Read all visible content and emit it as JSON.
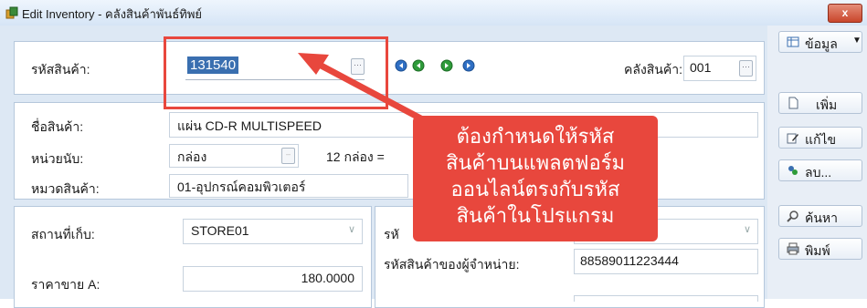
{
  "window": {
    "title": "Edit Inventory - คลังสินค้าพันธ์ทิพย์",
    "close_label": "x"
  },
  "header": {
    "product_code_label": "รหัสสินค้า:",
    "product_code_value": "131540",
    "warehouse_label": "คลังสินค้า:",
    "warehouse_value": "001"
  },
  "info": {
    "name_label": "ชื่อสินค้า:",
    "name_value": "แผ่น CD-R MULTISPEED",
    "unit_label": "หน่วยนับ:",
    "unit_value": "กล่อง",
    "unit_conversion": "12 กล่อง =",
    "category_label": "หมวดสินค้า:",
    "category_value": "01-อุปกรณ์คอมพิวเตอร์"
  },
  "storage": {
    "location_label": "สถานที่เก็บ:",
    "location_value": "STORE01",
    "price_a_label": "ราคาขาย A:",
    "price_a_value": "180.0000",
    "right_label_partial": "รหั",
    "supplier_code_label": "รหัสสินค้าของผู้จำหน่าย:",
    "supplier_code_value": "88589011223444"
  },
  "sidebar": {
    "data_label": "ข้อมูล",
    "add_label": "เพิ่ม",
    "edit_label": "แก้ไข",
    "delete_label": "ลบ...",
    "search_label": "ค้นหา",
    "print_label": "พิมพ์"
  },
  "annotation": {
    "lines": [
      "ต้องกำหนดให้รหัส",
      "สินค้าบนแพลตฟอร์ม",
      "ออนไลน์ตรงกับรหัส",
      "สินค้าในโปรแกรม"
    ],
    "color": "#e8473d"
  },
  "colors": {
    "accent": "#3a6fb0",
    "form_bg": "#dde8f4",
    "nav_green": "#2e9b3a",
    "nav_blue": "#2f6fc4"
  },
  "icons": [
    "app-icon",
    "first-record-icon",
    "prev-record-icon",
    "next-record-icon",
    "last-record-icon",
    "data-table-icon",
    "new-document-icon",
    "edit-pencil-icon",
    "delete-icon",
    "search-magnifier-icon",
    "printer-icon"
  ]
}
